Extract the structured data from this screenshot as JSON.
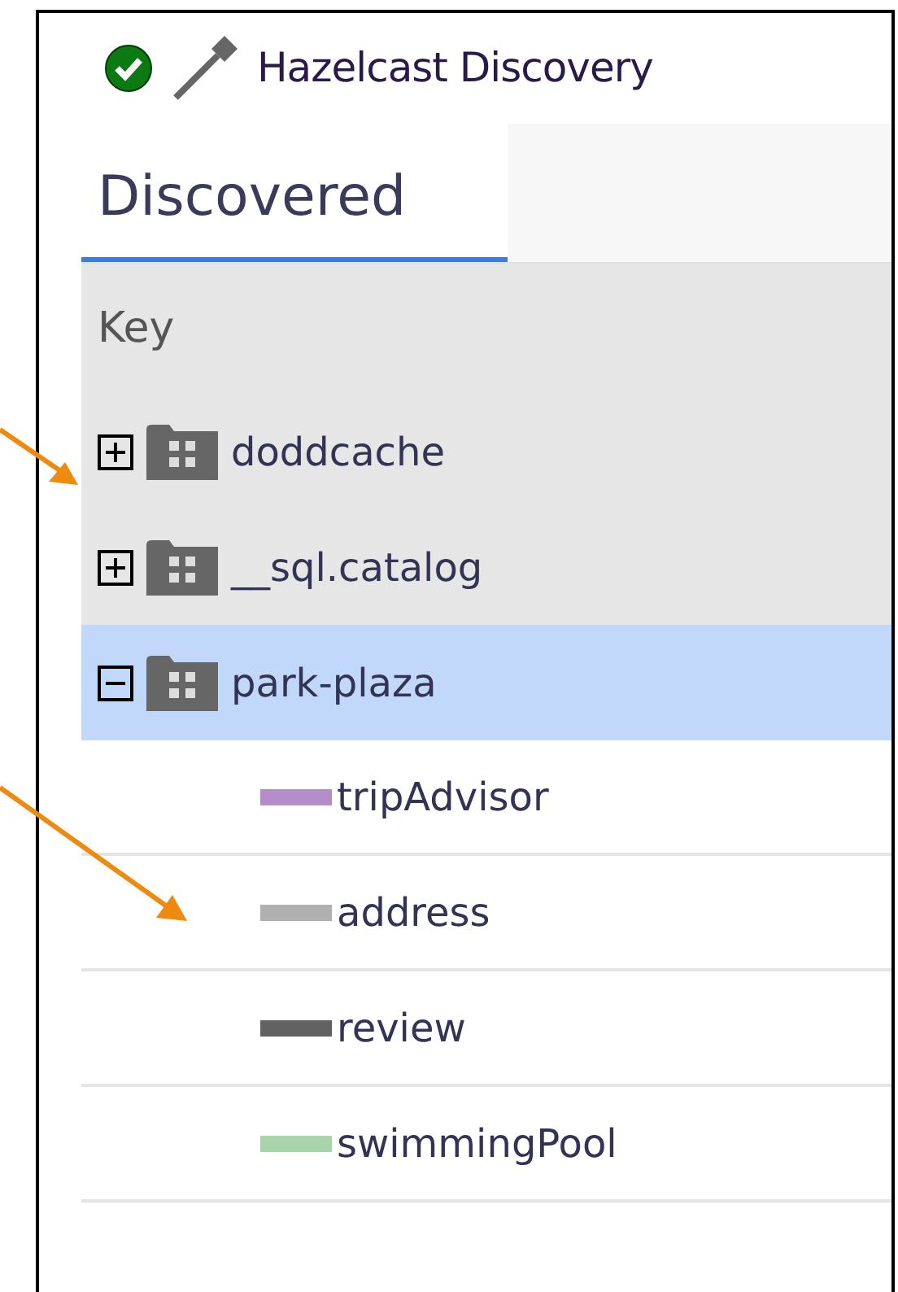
{
  "window": {
    "title": "Hazelcast Discovery",
    "connected": true
  },
  "tabs": [
    {
      "label": "Discovered",
      "selected": true
    }
  ],
  "table": {
    "columns": [
      "Key"
    ],
    "tree": [
      {
        "kind": "group",
        "label": "doddcache",
        "expanded": false,
        "selected": false
      },
      {
        "kind": "group",
        "label": "__sql.catalog",
        "expanded": false,
        "selected": false
      },
      {
        "kind": "group",
        "label": "park-plaza",
        "expanded": true,
        "selected": true,
        "children": [
          {
            "kind": "field",
            "label": "tripAdvisor",
            "color": "#b48cc8"
          },
          {
            "kind": "field",
            "label": "address",
            "color": "#b0b0b0"
          },
          {
            "kind": "field",
            "label": "review",
            "color": "#626262"
          },
          {
            "kind": "field",
            "label": "swimmingPool",
            "color": "#a8d4ac"
          }
        ]
      }
    ]
  }
}
